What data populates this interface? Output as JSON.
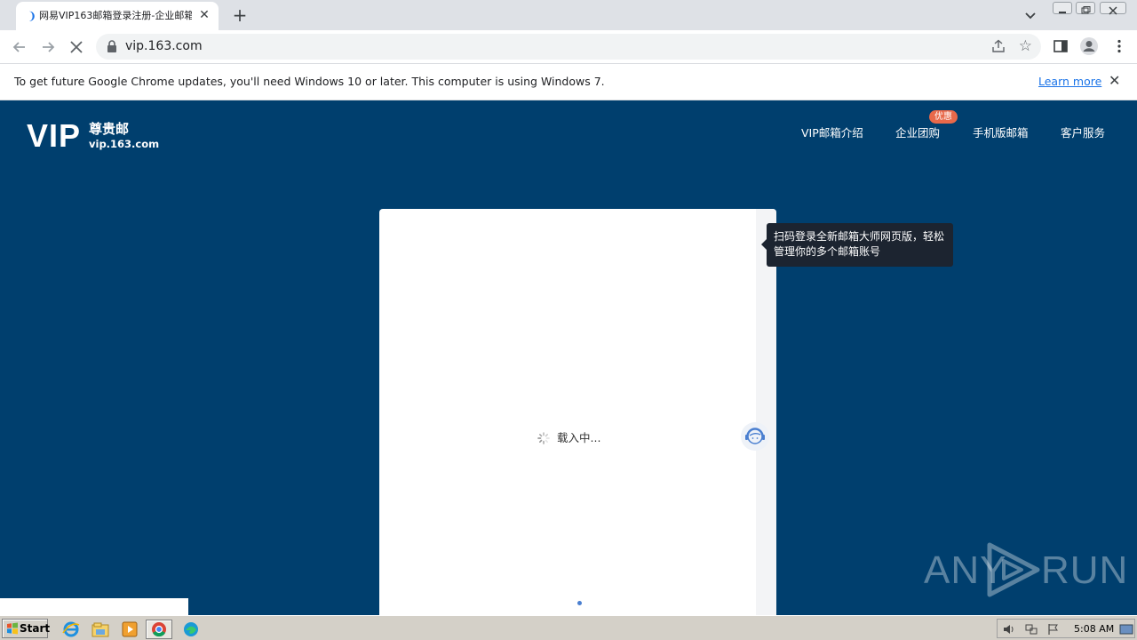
{
  "browser": {
    "tab": {
      "title": "网易VIP163邮箱登录注册-企业邮箱",
      "close_glyph": "✕"
    },
    "new_tab_glyph": "+",
    "address": "vip.163.com"
  },
  "infobar": {
    "message": "To get future Google Chrome updates, you'll need Windows 10 or later. This computer is using Windows 7.",
    "link": "Learn more",
    "close_glyph": "✕"
  },
  "site": {
    "logo_text": "VIP",
    "logo_cn": "尊贵邮",
    "logo_domain": "vip.163.com",
    "nav": [
      {
        "label": "VIP邮箱介绍"
      },
      {
        "label": "企业团购",
        "badge": "优惠"
      },
      {
        "label": "手机版邮箱"
      },
      {
        "label": "客户服务"
      }
    ],
    "loading_text": "载入中...",
    "tooltip": "扫码登录全新邮箱大师网页版，轻松管理你的多个邮箱账号"
  },
  "watermark": {
    "left": "ANY",
    "right": "RUN"
  },
  "taskbar": {
    "start_label": "Start",
    "clock": "5:08 AM"
  },
  "colors": {
    "page_bg": "#003f6e",
    "badge": "#e8694a",
    "link": "#1a73e8"
  }
}
